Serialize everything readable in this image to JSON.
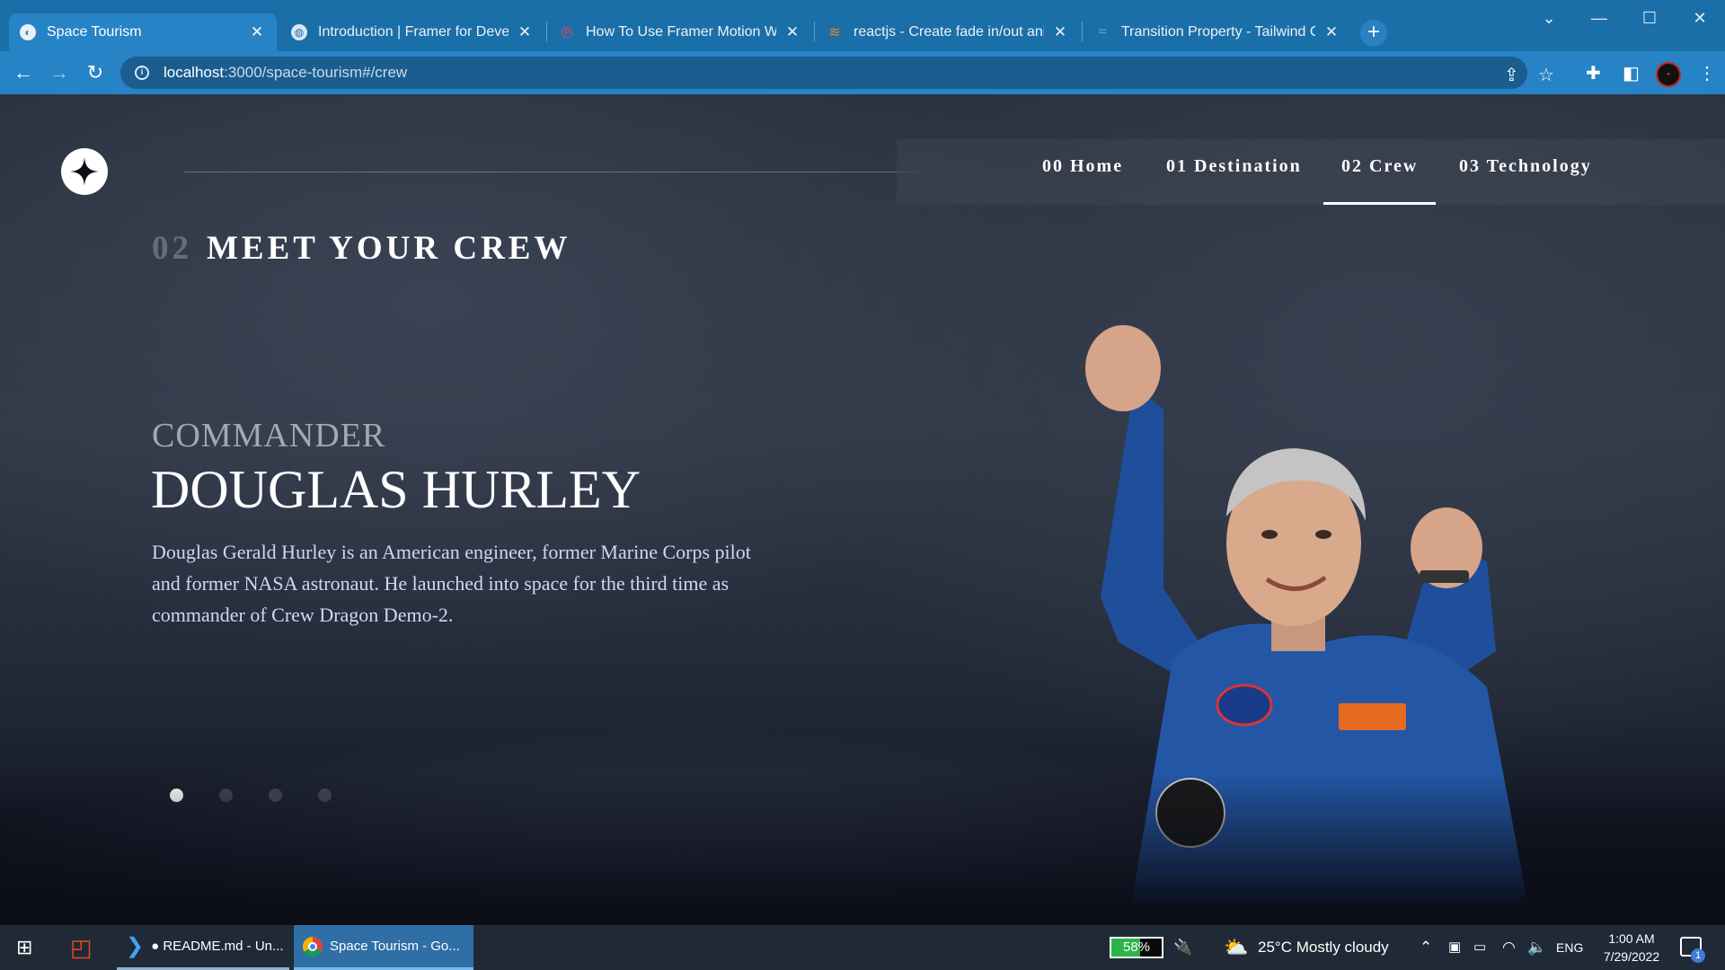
{
  "browser": {
    "tabs": [
      {
        "title": "Space Tourism",
        "active": true
      },
      {
        "title": "Introduction | Framer for Develop",
        "active": false
      },
      {
        "title": "How To Use Framer Motion With",
        "active": false
      },
      {
        "title": "reactjs - Create fade in/out anim:",
        "active": false
      },
      {
        "title": "Transition Property - Tailwind CSS",
        "active": false
      }
    ],
    "new_tab_label": "+",
    "url_host": "localhost",
    "url_path": ":3000/space-tourism#/crew",
    "status_url": "localhost:3000/space-tourism#/crew"
  },
  "site": {
    "nav": [
      {
        "num": "00",
        "label": "Home"
      },
      {
        "num": "01",
        "label": "Destination"
      },
      {
        "num": "02",
        "label": "Crew"
      },
      {
        "num": "03",
        "label": "Technology"
      }
    ],
    "active_nav": "Crew",
    "heading": {
      "num": "02",
      "text": "MEET YOUR CREW"
    },
    "crew": {
      "role": "COMMANDER",
      "name": "DOUGLAS HURLEY",
      "bio": "Douglas Gerald Hurley is an American engineer, former Marine Corps pilot and former NASA astronaut. He launched into space for the third time as commander of Crew Dragon Demo-2."
    },
    "slider": {
      "count": 4,
      "active_index": 0
    }
  },
  "taskbar": {
    "apps": [
      {
        "label": "● README.md - Un...",
        "icon": "vscode-icon"
      },
      {
        "label": "Space Tourism - Go...",
        "icon": "chrome-icon"
      }
    ],
    "battery": "58%",
    "battery_level": 0.58,
    "weather": "25°C  Mostly cloudy",
    "language": "ENG",
    "time": "1:00 AM",
    "date": "7/29/2022",
    "notifications": "1"
  },
  "colors": {
    "tab_bar": "#1b6fa8",
    "toolbar": "#2683c6",
    "page_bg": "#0b0d17",
    "bio_text": "#d0d6f9",
    "taskbar": "#1f2a36"
  }
}
